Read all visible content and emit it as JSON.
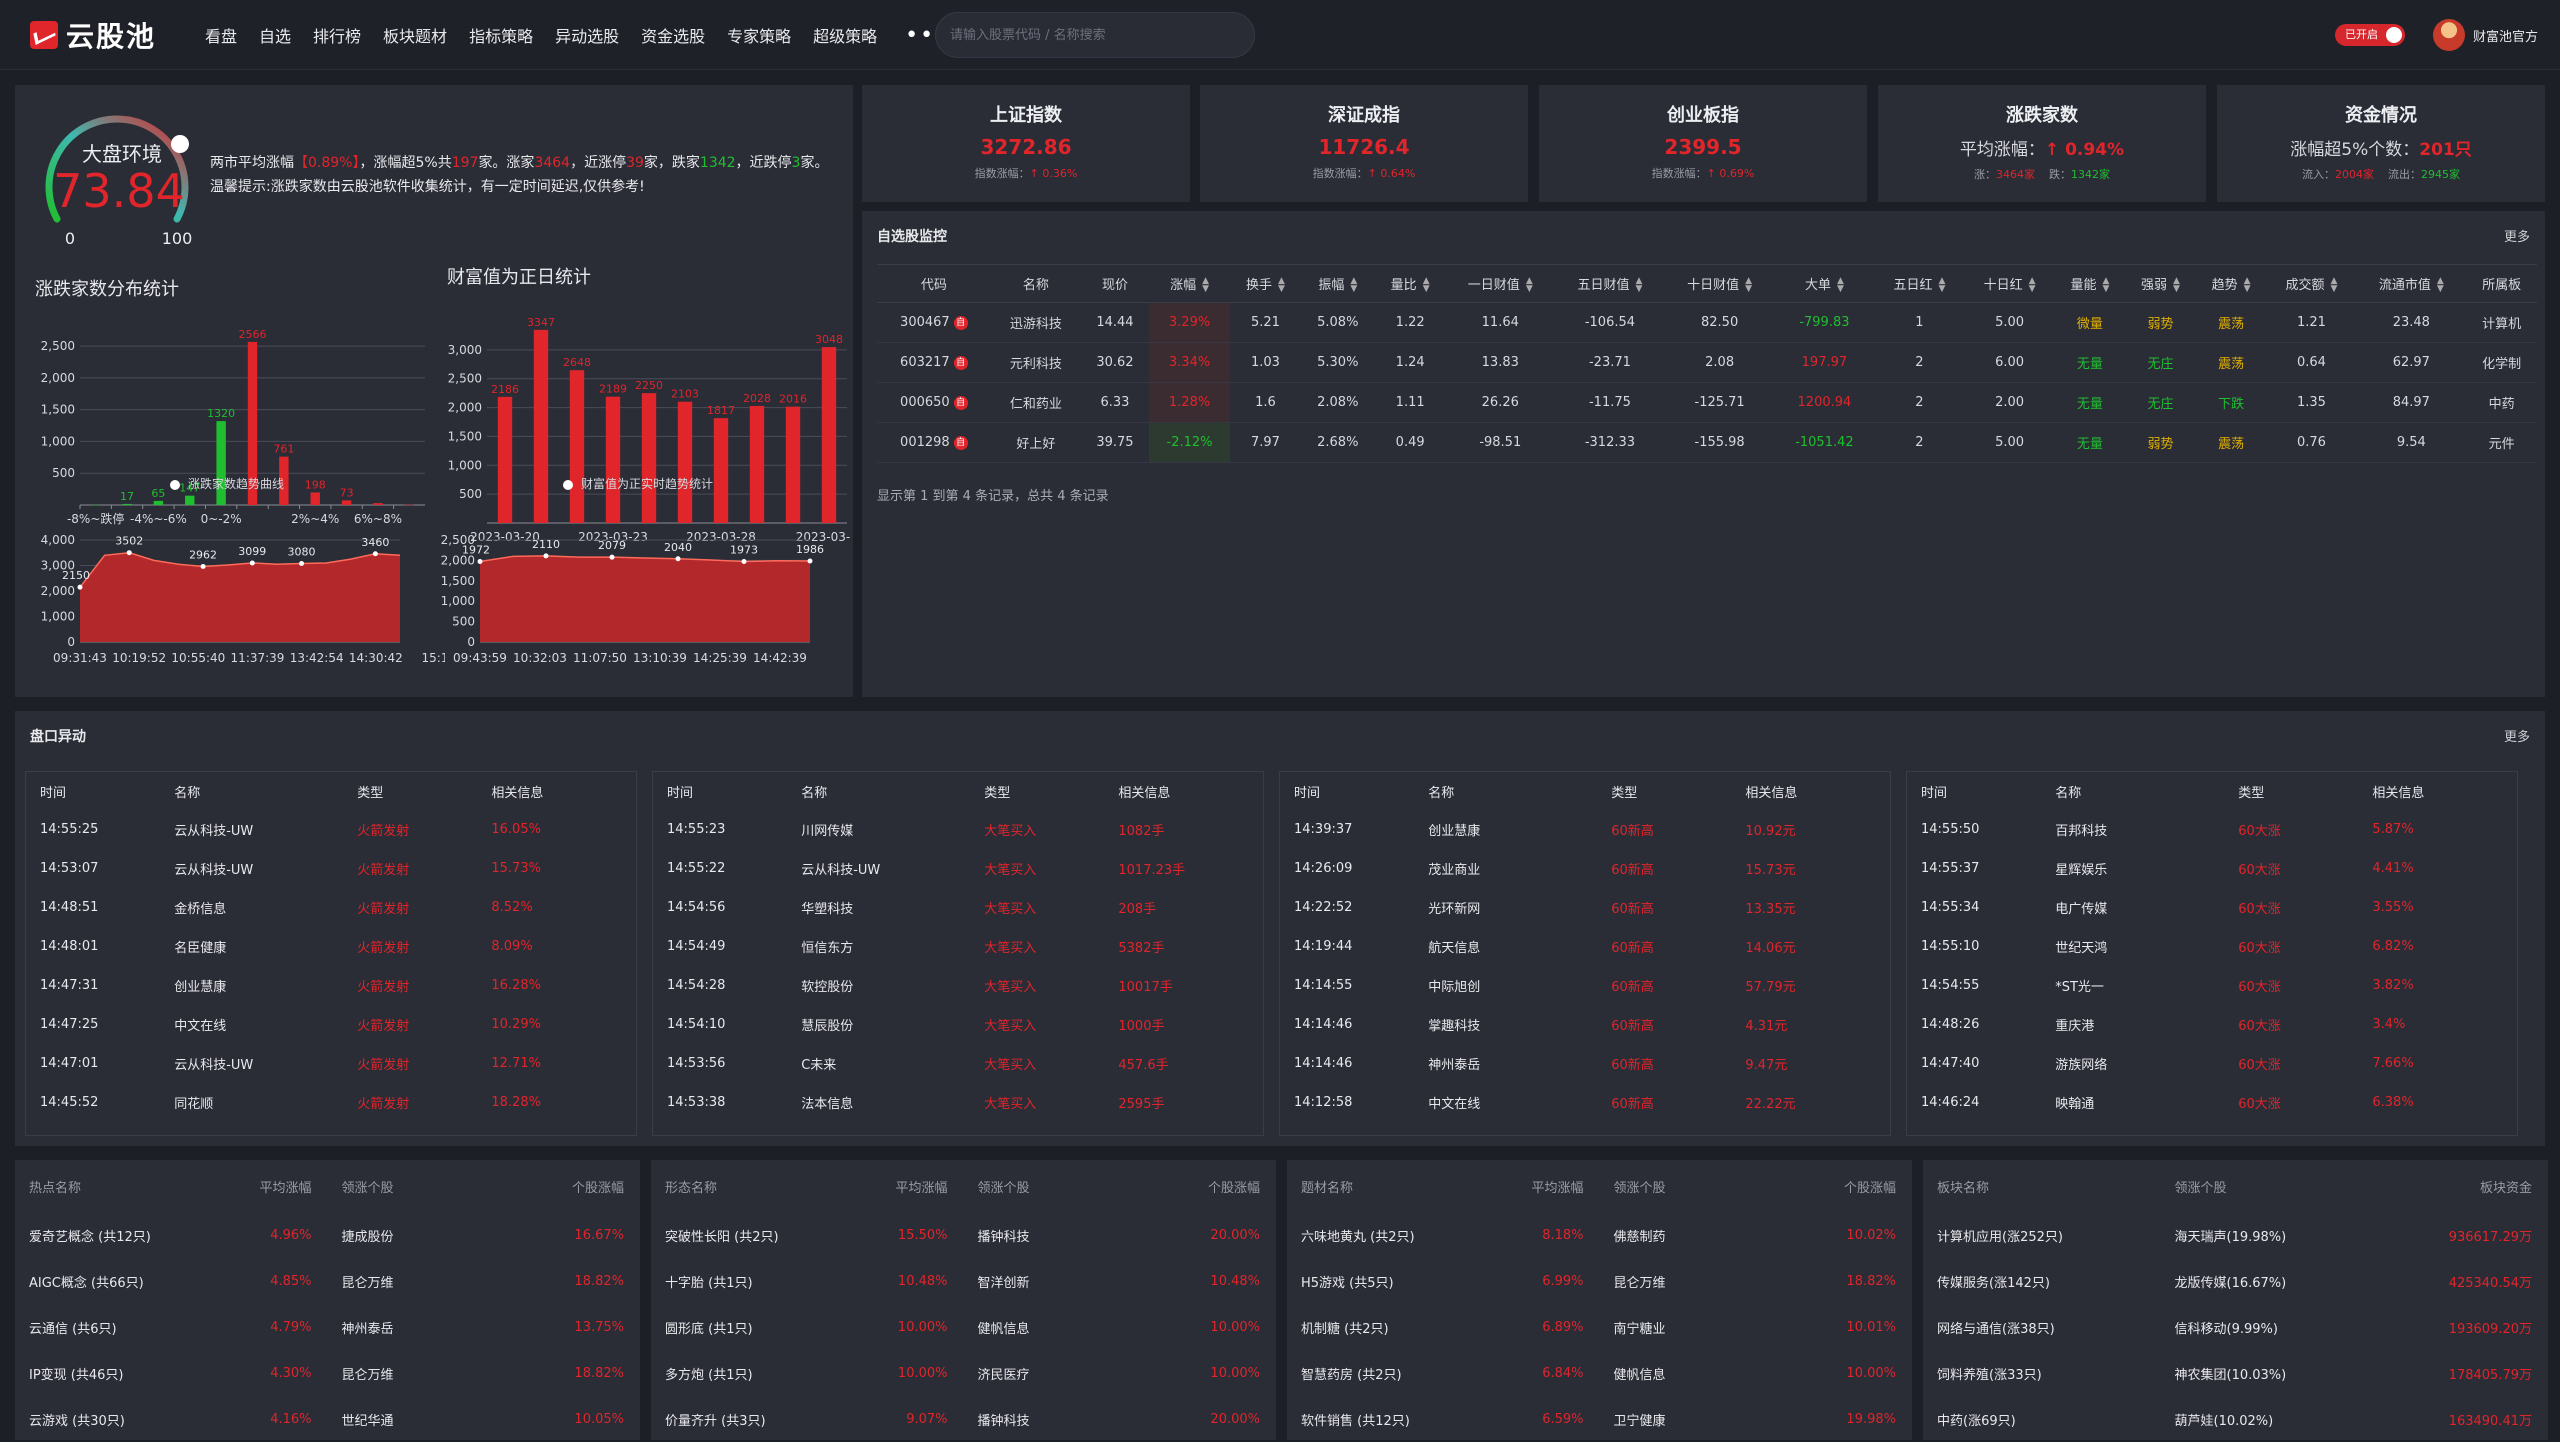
{
  "app": {
    "logo_text": "云股池",
    "search_placeholder": "请输入股票代码 / 名称搜索",
    "toggle_label": "已开启",
    "user_name": "财富池官方",
    "more_nav": "•••"
  },
  "nav": [
    "看盘",
    "自选",
    "排行榜",
    "板块题材",
    "指标策略",
    "异动选股",
    "资金选股",
    "专家策略",
    "超级策略"
  ],
  "colors": {
    "background": "#1d1f27",
    "panel": "#2a2c36",
    "up": "#e0252b",
    "down": "#1fbf2f",
    "neutral": "#e2b100"
  },
  "market": {
    "gauge_label": "大盘环境",
    "gauge_value": "73.84",
    "gauge_score": 73.84,
    "gauge_min": "0",
    "gauge_max": "100",
    "summary_parts": [
      {
        "t": "两市平均涨幅",
        "c": "white"
      },
      {
        "t": "【0.89%】",
        "c": "red"
      },
      {
        "t": "，涨幅超5%共",
        "c": "white"
      },
      {
        "t": "197",
        "c": "red"
      },
      {
        "t": "家。涨家",
        "c": "white"
      },
      {
        "t": "3464",
        "c": "red"
      },
      {
        "t": "，近涨停",
        "c": "white"
      },
      {
        "t": "39",
        "c": "red"
      },
      {
        "t": "家，跌家",
        "c": "white"
      },
      {
        "t": "1342",
        "c": "green"
      },
      {
        "t": "，近跌停",
        "c": "white"
      },
      {
        "t": "3",
        "c": "green"
      },
      {
        "t": "家。温馨提示:涨跌家数由云股池软件收集统计，有一定时间延迟,仅供参考!",
        "c": "white"
      }
    ],
    "dist_title": "涨跌家数分布统计",
    "wealth_title": "财富值为正日统计",
    "trend1_legend": "涨跌家数趋势曲线",
    "trend2_legend": "财富值为正实时趋势统计"
  },
  "chart_data": [
    {
      "type": "bar",
      "title": "涨跌家数分布统计",
      "categories": [
        "-8%~跌停",
        "",
        "-4%~-6%",
        "",
        "0~-2%",
        "",
        "",
        "2%~4%",
        "",
        "6%~8%",
        ""
      ],
      "values": [
        0,
        17,
        65,
        147,
        1320,
        2566,
        761,
        198,
        73,
        30,
        5
      ],
      "colors": [
        "green",
        "green",
        "green",
        "green",
        "green",
        "red",
        "red",
        "red",
        "red",
        "red",
        "red"
      ],
      "labels": [
        "",
        "17",
        "65",
        "147",
        "1320",
        "2566",
        "761",
        "198",
        "73",
        "",
        ""
      ],
      "yticks": [
        "500",
        "1,000",
        "1,500",
        "2,000",
        "2,500"
      ],
      "ylim": [
        0,
        2800
      ]
    },
    {
      "type": "bar",
      "title": "财富值为正日统计",
      "values": [
        2186,
        3347,
        2648,
        2189,
        2250,
        2102,
        1817,
        2028,
        2016,
        3048
      ],
      "labels": [
        "2186",
        "3347",
        "2648",
        "2189",
        "2250",
        "2103",
        "1817",
        "2028",
        "2016",
        "3048"
      ],
      "xticks": [
        "2023-03-20",
        "2023-03-23",
        "2023-03-28",
        "2023-03-"
      ],
      "yticks": [
        "500",
        "1,000",
        "1,500",
        "2,000",
        "2,500",
        "3,000"
      ],
      "ylim": [
        0,
        3500
      ]
    },
    {
      "type": "area",
      "title": "涨跌家数趋势曲线",
      "values": [
        2150,
        3400,
        3502,
        3200,
        3050,
        2962,
        3020,
        3099,
        3050,
        3080,
        3100,
        3250,
        3460,
        3400
      ],
      "labels": [
        "2150",
        "3502",
        "2962",
        "3099",
        "3080",
        "3460"
      ],
      "label_points": [
        0,
        2,
        5,
        7,
        9,
        12
      ],
      "xticks": [
        "09:31:43",
        "10:19:52",
        "10:55:40",
        "11:37:39",
        "13:42:54",
        "14:30:42",
        "15:1"
      ],
      "yticks": [
        "0",
        "1,000",
        "2,000",
        "3,000",
        "4,000"
      ],
      "ylim": [
        0,
        4000
      ]
    },
    {
      "type": "area",
      "title": "财富值为正实时趋势统计",
      "values": [
        1972,
        2100,
        2110,
        2080,
        2079,
        2060,
        2040,
        2010,
        1973,
        1990,
        1986
      ],
      "labels": [
        "1972",
        "2110",
        "2079",
        "2040",
        "1973",
        "1986"
      ],
      "label_points": [
        0,
        2,
        4,
        6,
        8,
        10
      ],
      "xticks": [
        "09:43:59",
        "10:32:03",
        "11:07:50",
        "13:10:39",
        "14:25:39",
        "14:42:39"
      ],
      "yticks": [
        "0",
        "500",
        "1,000",
        "1,500",
        "2,000",
        "2,500"
      ],
      "ylim": [
        0,
        2500
      ]
    }
  ],
  "index_cards": [
    {
      "title": "上证指数",
      "value": "3272.86",
      "sub_label": "指数涨幅：",
      "sub_value": "0.36%"
    },
    {
      "title": "深证成指",
      "value": "11726.4",
      "sub_label": "指数涨幅：",
      "sub_value": "0.64%"
    },
    {
      "title": "创业板指",
      "value": "2399.5",
      "sub_label": "指数涨幅：",
      "sub_value": "0.69%"
    },
    {
      "title": "涨跌家数",
      "value_prefix": "平均涨幅：",
      "value": "0.94%",
      "sub_label": "涨：",
      "sub_value": "3464家",
      "sub_label2": "跌：",
      "sub_value2": "1342家"
    },
    {
      "title": "资金情况",
      "value_prefix": "涨幅超5%个数：",
      "value": "201只",
      "sub_label": "流入：",
      "sub_value": "2004家",
      "sub_label2": "流出：",
      "sub_value2": "2945家"
    }
  ],
  "watch": {
    "title": "自选股监控",
    "more": "更多",
    "headers": [
      "代码",
      "名称",
      "现价",
      "涨幅",
      "换手",
      "振幅",
      "量比",
      "一日财值",
      "五日财值",
      "十日财值",
      "大单",
      "五日红",
      "十日红",
      "量能",
      "强弱",
      "趋势",
      "成交额",
      "流通市值",
      "所属板"
    ],
    "sortable": [
      false,
      false,
      false,
      true,
      true,
      true,
      true,
      true,
      true,
      true,
      true,
      true,
      true,
      true,
      true,
      true,
      true,
      true,
      false
    ],
    "rows": [
      [
        "300467",
        "迅游科技",
        "14.44",
        "3.29%",
        "5.21",
        "5.08%",
        "1.22",
        "11.64",
        "-106.54",
        "82.50",
        "-799.83",
        "1",
        "5.00",
        "微量",
        "弱势",
        "震荡",
        "1.21",
        "23.48",
        "计算机"
      ],
      [
        "603217",
        "元利科技",
        "30.62",
        "3.34%",
        "1.03",
        "5.30%",
        "1.24",
        "13.83",
        "-23.71",
        "2.08",
        "197.97",
        "2",
        "6.00",
        "无量",
        "无庄",
        "震荡",
        "0.64",
        "62.97",
        "化学制"
      ],
      [
        "000650",
        "仁和药业",
        "6.33",
        "1.28%",
        "1.6",
        "2.08%",
        "1.11",
        "26.26",
        "-11.75",
        "-125.71",
        "1200.94",
        "2",
        "2.00",
        "无量",
        "无庄",
        "下跌",
        "1.35",
        "84.97",
        "中药"
      ],
      [
        "001298",
        "好上好",
        "39.75",
        "-2.12%",
        "7.97",
        "2.68%",
        "0.49",
        "-98.51",
        "-312.33",
        "-155.98",
        "-1051.42",
        "2",
        "5.00",
        "无量",
        "弱势",
        "震荡",
        "0.76",
        "9.54",
        "元件"
      ]
    ],
    "badge": "自",
    "footer": "显示第 1 到第 4 条记录，总共 4 条记录"
  },
  "move": {
    "title": "盘口异动",
    "more": "更多",
    "headers": [
      "时间",
      "名称",
      "类型",
      "相关信息"
    ],
    "cols": [
      [
        [
          "14:55:25",
          "云从科技-UW",
          "火箭发射",
          "16.05%"
        ],
        [
          "14:53:07",
          "云从科技-UW",
          "火箭发射",
          "15.73%"
        ],
        [
          "14:48:51",
          "金桥信息",
          "火箭发射",
          "8.52%"
        ],
        [
          "14:48:01",
          "名臣健康",
          "火箭发射",
          "8.09%"
        ],
        [
          "14:47:31",
          "创业慧康",
          "火箭发射",
          "16.28%"
        ],
        [
          "14:47:25",
          "中文在线",
          "火箭发射",
          "10.29%"
        ],
        [
          "14:47:01",
          "云从科技-UW",
          "火箭发射",
          "12.71%"
        ],
        [
          "14:45:52",
          "同花顺",
          "火箭发射",
          "18.28%"
        ]
      ],
      [
        [
          "14:55:23",
          "川网传媒",
          "大笔买入",
          "1082手"
        ],
        [
          "14:55:22",
          "云从科技-UW",
          "大笔买入",
          "1017.23手"
        ],
        [
          "14:54:56",
          "华塑科技",
          "大笔买入",
          "208手"
        ],
        [
          "14:54:49",
          "恒信东方",
          "大笔买入",
          "5382手"
        ],
        [
          "14:54:28",
          "软控股份",
          "大笔买入",
          "10017手"
        ],
        [
          "14:54:10",
          "慧辰股份",
          "大笔买入",
          "1000手"
        ],
        [
          "14:53:56",
          "C未来",
          "大笔买入",
          "457.6手"
        ],
        [
          "14:53:38",
          "法本信息",
          "大笔买入",
          "2595手"
        ]
      ],
      [
        [
          "14:39:37",
          "创业慧康",
          "60新高",
          "10.92元"
        ],
        [
          "14:26:09",
          "茂业商业",
          "60新高",
          "15.73元"
        ],
        [
          "14:22:52",
          "光环新网",
          "60新高",
          "13.35元"
        ],
        [
          "14:19:44",
          "航天信息",
          "60新高",
          "14.06元"
        ],
        [
          "14:14:55",
          "中际旭创",
          "60新高",
          "57.79元"
        ],
        [
          "14:14:46",
          "掌趣科技",
          "60新高",
          "4.31元"
        ],
        [
          "14:14:46",
          "神州泰岳",
          "60新高",
          "9.47元"
        ],
        [
          "14:12:58",
          "中文在线",
          "60新高",
          "22.22元"
        ]
      ],
      [
        [
          "14:55:50",
          "百邦科技",
          "60大涨",
          "5.87%"
        ],
        [
          "14:55:37",
          "星辉娱乐",
          "60大涨",
          "4.41%"
        ],
        [
          "14:55:34",
          "电广传媒",
          "60大涨",
          "3.55%"
        ],
        [
          "14:55:10",
          "世纪天鸿",
          "60大涨",
          "6.82%"
        ],
        [
          "14:54:55",
          "*ST光一",
          "60大涨",
          "3.82%"
        ],
        [
          "14:48:26",
          "重庆港",
          "60大涨",
          "3.4%"
        ],
        [
          "14:47:40",
          "游族网络",
          "60大涨",
          "7.66%"
        ],
        [
          "14:46:24",
          "映翰通",
          "60大涨",
          "6.38%"
        ]
      ]
    ]
  },
  "bottom": [
    {
      "headers": [
        "热点名称",
        "平均涨幅",
        "领涨个股",
        "个股涨幅"
      ],
      "rows": [
        [
          "爱奇艺概念 (共12只)",
          "4.96%",
          "捷成股份",
          "16.67%"
        ],
        [
          "AIGC概念 (共66只)",
          "4.85%",
          "昆仑万维",
          "18.82%"
        ],
        [
          "云通信 (共6只)",
          "4.79%",
          "神州泰岳",
          "13.75%"
        ],
        [
          "IP变现 (共46只)",
          "4.30%",
          "昆仑万维",
          "18.82%"
        ],
        [
          "云游戏 (共30只)",
          "4.16%",
          "世纪华通",
          "10.05%"
        ]
      ]
    },
    {
      "headers": [
        "形态名称",
        "平均涨幅",
        "领涨个股",
        "个股涨幅"
      ],
      "rows": [
        [
          "突破性长阳 (共2只)",
          "15.50%",
          "播钟科技",
          "20.00%"
        ],
        [
          "十字胎 (共1只)",
          "10.48%",
          "智洋创新",
          "10.48%"
        ],
        [
          "圆形底 (共1只)",
          "10.00%",
          "健帆信息",
          "10.00%"
        ],
        [
          "多方炮 (共1只)",
          "10.00%",
          "济民医疗",
          "10.00%"
        ],
        [
          "价量齐升 (共3只)",
          "9.07%",
          "播钟科技",
          "20.00%"
        ]
      ]
    },
    {
      "headers": [
        "题材名称",
        "平均涨幅",
        "领涨个股",
        "个股涨幅"
      ],
      "rows": [
        [
          "六味地黄丸 (共2只)",
          "8.18%",
          "佛慈制药",
          "10.02%"
        ],
        [
          "H5游戏 (共5只)",
          "6.99%",
          "昆仑万维",
          "18.82%"
        ],
        [
          "机制糖 (共2只)",
          "6.89%",
          "南宁糖业",
          "10.01%"
        ],
        [
          "智慧药房 (共2只)",
          "6.84%",
          "健帆信息",
          "10.00%"
        ],
        [
          "软件销售 (共12只)",
          "6.59%",
          "卫宁健康",
          "19.98%"
        ]
      ]
    },
    {
      "headers": [
        "板块名称",
        "领涨个股",
        "板块资金"
      ],
      "rows": [
        [
          "计算机应用(涨252只)",
          "海天瑞声(19.98%)",
          "936617.29万"
        ],
        [
          "传媒服务(涨142只)",
          "龙版传媒(16.67%)",
          "425340.54万"
        ],
        [
          "网络与通信(涨38只)",
          "信科移动(9.99%)",
          "193609.20万"
        ],
        [
          "饲料养殖(涨33只)",
          "神农集团(10.03%)",
          "178405.79万"
        ],
        [
          "中药(涨69只)",
          "葫芦娃(10.02%)",
          "163490.41万"
        ]
      ]
    }
  ]
}
